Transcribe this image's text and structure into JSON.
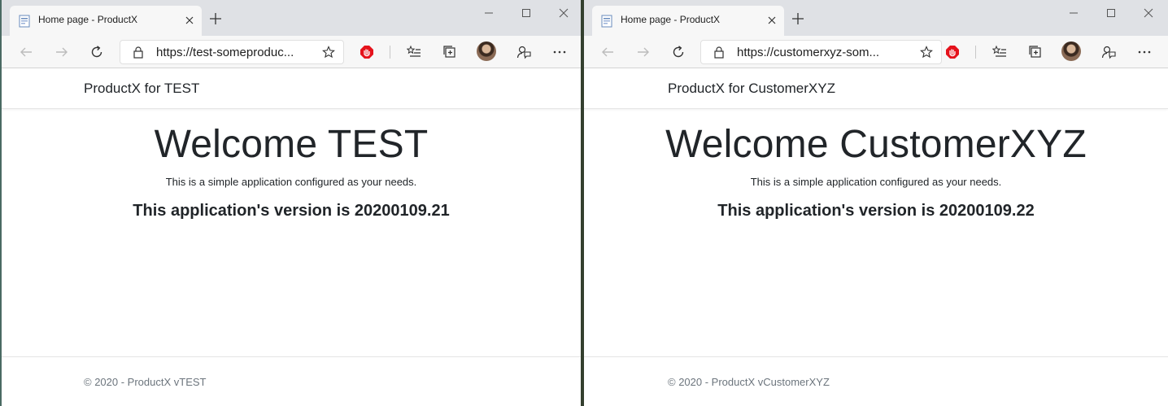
{
  "windows": [
    {
      "tab_title": "Home page - ProductX",
      "url": "https://test-someproduc...",
      "brand": "ProductX for TEST",
      "welcome": "Welcome TEST",
      "tagline": "This is a simple application configured as your needs.",
      "version": "This application's version is 20200109.21",
      "footer": "© 2020 - ProductX vTEST"
    },
    {
      "tab_title": "Home page - ProductX",
      "url": "https://customerxyz-som...",
      "brand": "ProductX for CustomerXYZ",
      "welcome": "Welcome CustomerXYZ",
      "tagline": "This is a simple application configured as your needs.",
      "version": "This application's version is 20200109.22",
      "footer": "© 2020 - ProductX vCustomerXYZ"
    }
  ],
  "icons": {
    "back": "back-arrow-icon",
    "forward": "forward-arrow-icon",
    "refresh": "refresh-icon",
    "lock": "lock-icon",
    "favorite": "star-icon",
    "extension": "adblock-stop-icon",
    "favorites": "favorites-list-icon",
    "collections": "collections-icon",
    "feedback": "feedback-icon",
    "more": "more-icon"
  },
  "colors": {
    "extension": "#e5131c",
    "page_bg": "#ffffff",
    "tab_strip": "#dfe1e5"
  }
}
